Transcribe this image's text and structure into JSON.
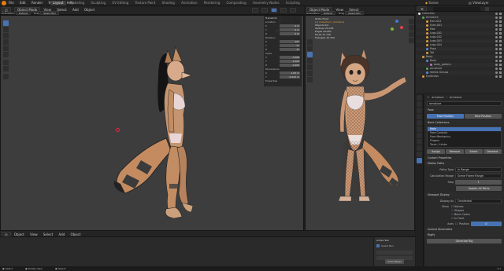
{
  "topbar": {
    "menus": [
      "File",
      "Edit",
      "Render",
      "Window",
      "Help"
    ],
    "workspaces": [
      "Layout",
      "Modeling",
      "Sculpting",
      "UV Editing",
      "Texture Paint",
      "Shading",
      "Animation",
      "Rendering",
      "Compositing",
      "Geometry Nodes",
      "Scripting"
    ],
    "active_workspace": "Layout",
    "scene_label": "Scene",
    "view_layer_label": "ViewLayer"
  },
  "header_left": {
    "editor_icon": "3d-viewport-icon",
    "mode": "Object Mode",
    "menus": [
      "View",
      "Select",
      "Add",
      "Object"
    ],
    "orientation_label": "Orientation",
    "orientation_value": "Default",
    "drag_label": "Drag",
    "drag_value": "Select Box"
  },
  "header_right": {
    "mode": "Object Mode",
    "menus": [
      "View",
      "Select",
      "Add",
      "Object"
    ],
    "orientation_label": "Orientation",
    "orientation_value": "Default",
    "drag_label": "Drag",
    "drag_value": "Select Box"
  },
  "overlay_right": {
    "title": "Ortho Front",
    "subtitle": "(1) Collection | Armature",
    "stats": [
      {
        "label": "Objects",
        "value": "0/4"
      },
      {
        "label": "Vertices",
        "value": "23,478"
      },
      {
        "label": "Edges",
        "value": "44,950"
      },
      {
        "label": "Faces",
        "value": "21,749"
      },
      {
        "label": "Triangles",
        "value": "42,334"
      }
    ]
  },
  "npanel": {
    "section_transform": "Transform",
    "location_label": "Location",
    "rotation_label": "Rotation",
    "scale_label": "Scale",
    "dimensions_label": "Dimensions",
    "axes": [
      "X",
      "Y",
      "Z"
    ],
    "location": [
      "0 m",
      "0 m",
      "0 m"
    ],
    "rotation": [
      "90°",
      "0°",
      "0°"
    ],
    "scale": [
      "1.000",
      "1.000",
      "1.000"
    ],
    "dimensions": [
      "1.82 m",
      "0.415 m",
      "1.98 m"
    ],
    "mode_label": "XYZ Euler",
    "properties_label": "Properties"
  },
  "outliner": {
    "search_placeholder": "",
    "display_mode": "Outliner",
    "items": [
      {
        "name": "Collection",
        "depth": 0,
        "color": "#e2e2e2"
      },
      {
        "name": "Armature",
        "depth": 1,
        "color": "#5ea35c"
      },
      {
        "name": "Ears.001",
        "depth": 2,
        "color": "#e0a03a"
      },
      {
        "name": "Eyes.001",
        "depth": 2,
        "color": "#e0a03a"
      },
      {
        "name": "Hair",
        "depth": 2,
        "color": "#e0a03a"
      },
      {
        "name": "Legs.001",
        "depth": 2,
        "color": "#e0a03a"
      },
      {
        "name": "Legs.002",
        "depth": 2,
        "color": "#e0a03a"
      },
      {
        "name": "Legs.003",
        "depth": 2,
        "color": "#e0a03a"
      },
      {
        "name": "Legs.004",
        "depth": 2,
        "color": "#e0a03a"
      },
      {
        "name": "Pose",
        "depth": 2,
        "color": "#5a8ad6"
      },
      {
        "name": "Tail",
        "depth": 2,
        "color": "#e0a03a"
      },
      {
        "name": "Body",
        "depth": 1,
        "color": "#e0a03a"
      },
      {
        "name": "Body",
        "depth": 2,
        "color": "#5a8ad6"
      },
      {
        "name": "body_pattern",
        "depth": 3,
        "color": "#c06ad0"
      },
      {
        "name": "armature",
        "depth": 2,
        "color": "#5ea35c"
      },
      {
        "name": "Vertex Groups",
        "depth": 2,
        "color": "#5a8ad6"
      },
      {
        "name": "Eyebrows",
        "depth": 1,
        "color": "#e0a03a"
      }
    ]
  },
  "properties": {
    "object_name": "armature",
    "data_name": "Armature",
    "sections": {
      "pose": "Pose",
      "pose_position": "Pose Position",
      "rest_position": "Rest Position",
      "bone_collections": "Bone Collections",
      "bone_collection_items": [
        "Main",
        "Face Controls",
        "Face Mechanics",
        "Fingers",
        "Torso / Limbs"
      ],
      "assign": "Assign",
      "remove": "Remove",
      "select": "Select",
      "deselect": "Deselect",
      "motion_paths": "Motion Paths",
      "paths_type": "Paths Type",
      "paths_type_value": "In Range",
      "calculation_range": "Calculation Range",
      "calculation_range_value": "Scene Frame Range",
      "step": "Step",
      "step_value": "1",
      "update_paths": "Update All Paths",
      "viewport_display": "Viewport Display",
      "display_as": "Display As",
      "display_as_value": "Octahedral",
      "show": "Show",
      "show_names": "Names",
      "show_shapes": "Shapes",
      "show_group_colors": "Bone Colors",
      "in_front": "In Front",
      "axes": "Axes",
      "position_label": "Position",
      "position_value": "0",
      "inverse_kinematics": "Inverse Kinematics",
      "rigify": "Rigify",
      "generate_rig": "Generate Rig",
      "custom_properties": "Custom Properties"
    }
  },
  "timeline": {
    "menus": [
      "Object",
      "View",
      "Select",
      "Add",
      "Object"
    ],
    "panel_title": "Active Tool",
    "panel_item": "Select Box",
    "anim_player": "Anim Player"
  },
  "status": {
    "left": "Select",
    "mid": "Rotate View",
    "right": "Object",
    "version": "4.1"
  },
  "colors": {
    "accent": "#4772b3",
    "viewport_bg": "#3d3d3d",
    "panel_bg": "#2a2a2a"
  }
}
